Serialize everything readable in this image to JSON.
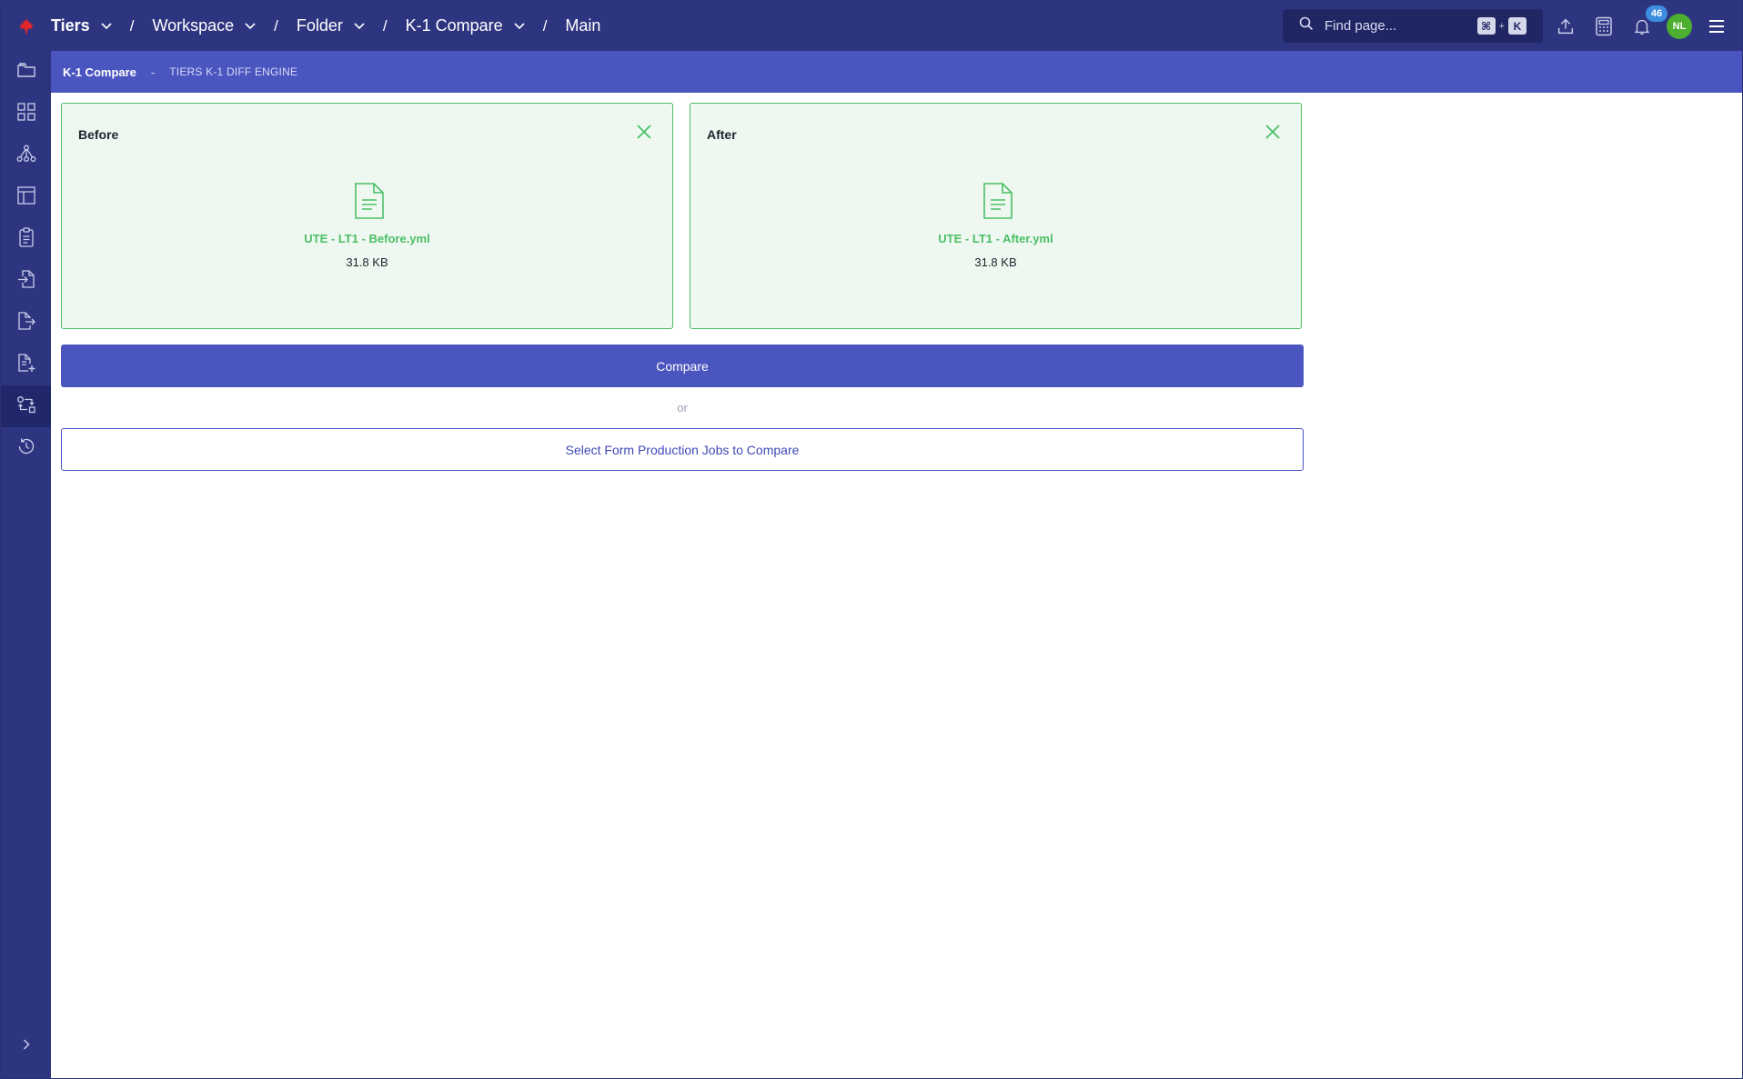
{
  "breadcrumbs": [
    {
      "label": "Tiers"
    },
    {
      "label": "Workspace"
    },
    {
      "label": "Folder"
    },
    {
      "label": "K-1 Compare"
    },
    {
      "label": "Main"
    }
  ],
  "breadcrumb_separator": "/",
  "search": {
    "placeholder": "Find page...",
    "shortcut_mod": "⌘",
    "shortcut_plus": "+",
    "shortcut_key": "K"
  },
  "notifications": {
    "count": "46"
  },
  "user": {
    "initials": "NL"
  },
  "subheader": {
    "title": "K-1 Compare",
    "dash": "-",
    "subtitle": "TIERS K-1 DIFF ENGINE"
  },
  "before": {
    "title": "Before",
    "file_name": "UTE - LT1 - Before.yml",
    "file_size": "31.8 KB"
  },
  "after": {
    "title": "After",
    "file_name": "UTE - LT1 - After.yml",
    "file_size": "31.8 KB"
  },
  "actions": {
    "compare_label": "Compare",
    "or_label": "or",
    "select_jobs_label": "Select Form Production Jobs to Compare"
  },
  "sidebar_icons": [
    "folder-icon",
    "dashboard-grid-icon",
    "hierarchy-icon",
    "table-layout-icon",
    "clipboard-icon",
    "file-import-icon",
    "file-export-icon",
    "file-add-icon",
    "compare-icon",
    "history-icon"
  ],
  "colors": {
    "topbar": "#2d3580",
    "accent": "#4b55c0",
    "success": "#4bbf67",
    "avatar": "#4caf2f",
    "badge": "#3c8ddf"
  }
}
